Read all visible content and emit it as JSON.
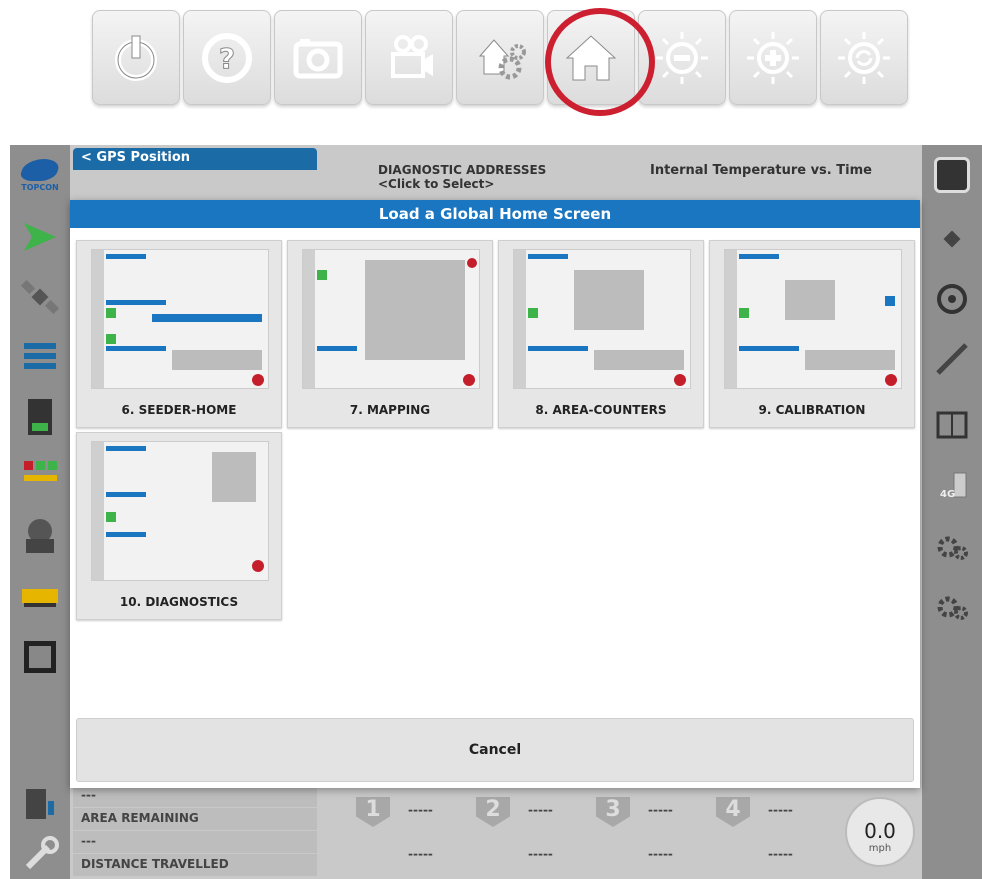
{
  "toolbar": {
    "buttons": [
      {
        "name": "power-button",
        "icon": "power-icon"
      },
      {
        "name": "help-button",
        "icon": "question-icon"
      },
      {
        "name": "screenshot-button",
        "icon": "camera-icon"
      },
      {
        "name": "video-button",
        "icon": "video-camera-icon"
      },
      {
        "name": "home-settings-button",
        "icon": "home-gear-icon"
      },
      {
        "name": "home-button",
        "icon": "home-icon"
      },
      {
        "name": "brightness-down-button",
        "icon": "brightness-minus-icon"
      },
      {
        "name": "brightness-up-button",
        "icon": "brightness-plus-icon"
      },
      {
        "name": "brightness-auto-button",
        "icon": "brightness-auto-icon"
      }
    ],
    "highlight_color": "#cc1f2f"
  },
  "background": {
    "gps_tab": "< GPS Position",
    "diag_title": "DIAGNOSTIC ADDRESSES",
    "diag_sub": "<Click to Select>",
    "temp_title": "Internal Temperature vs. Time",
    "bottom_rows": [
      "---",
      "AREA REMAINING",
      "---",
      "DISTANCE TRAVELLED",
      "---"
    ],
    "counters": [
      {
        "num": "1",
        "value": "-----"
      },
      {
        "num": "2",
        "value": "-----"
      },
      {
        "num": "3",
        "value": "-----"
      },
      {
        "num": "4",
        "value": "-----"
      }
    ],
    "lower_counters": [
      "-----",
      "-----",
      "-----",
      "-----"
    ],
    "speed": {
      "value": "0.0",
      "unit": "mph"
    }
  },
  "modal": {
    "title": "Load a Global Home Screen",
    "cards": [
      {
        "label": "6. SEEDER-HOME"
      },
      {
        "label": "7. MAPPING"
      },
      {
        "label": "8. AREA-COUNTERS"
      },
      {
        "label": "9. CALIBRATION"
      },
      {
        "label": "10. DIAGNOSTICS"
      }
    ],
    "cancel_label": "Cancel"
  },
  "colors": {
    "header_blue": "#1b76c1",
    "brand_blue": "#1d5fa6",
    "status_red": "#c41e2a"
  }
}
